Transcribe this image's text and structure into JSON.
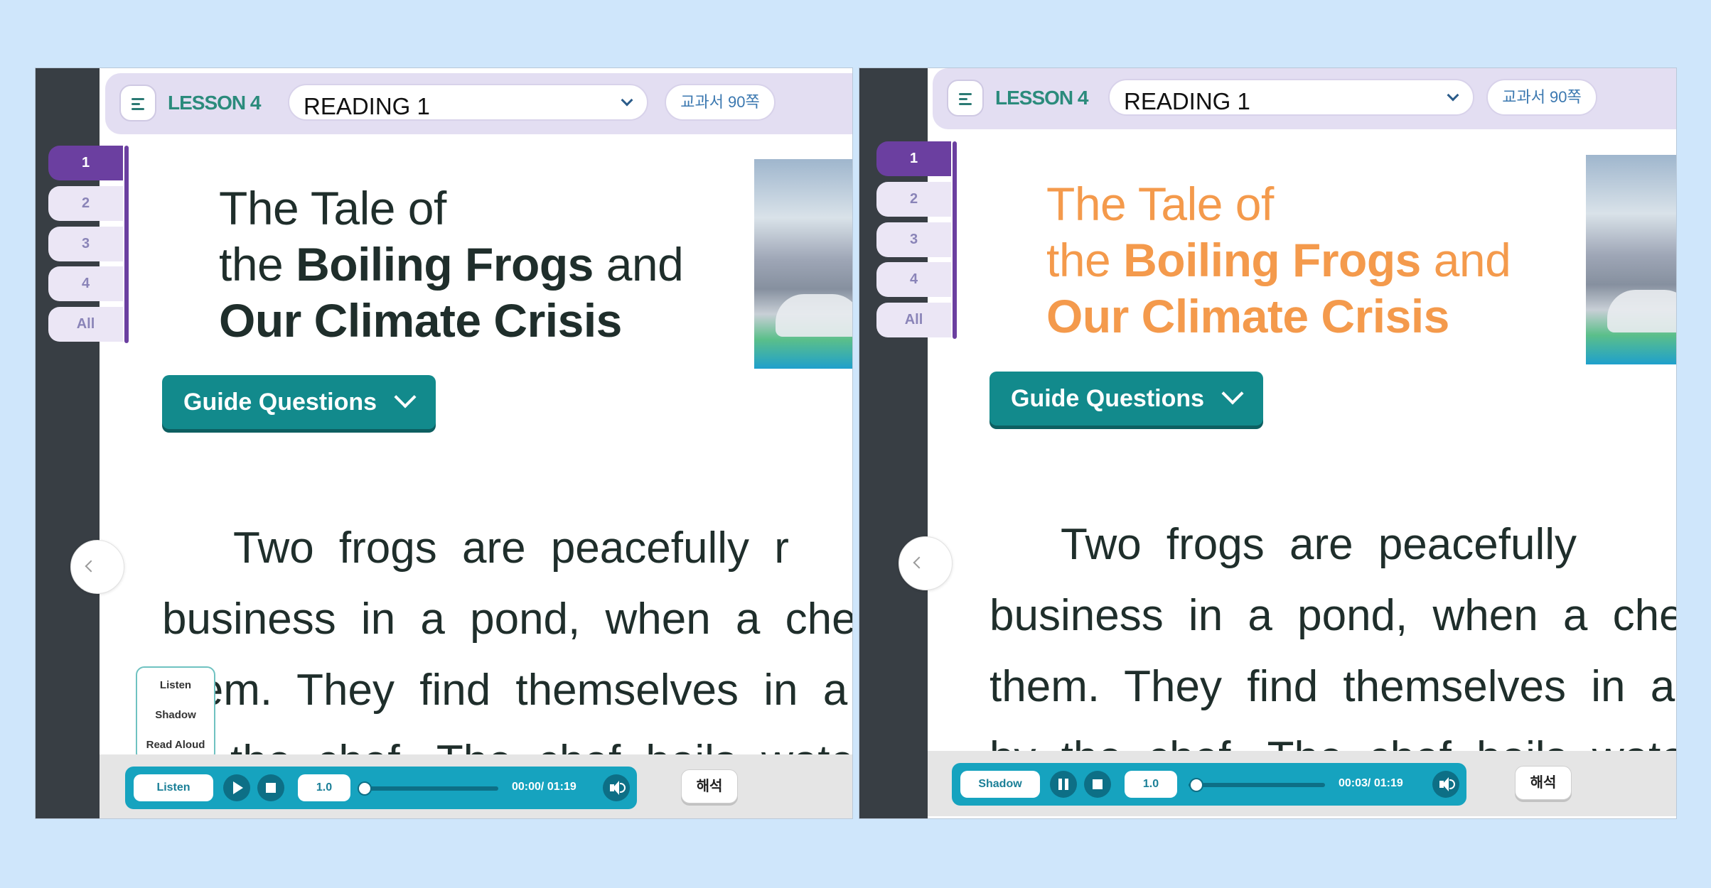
{
  "screens": [
    {
      "id": "left",
      "header": {
        "lesson": "LESSON 4",
        "reading_select": "READING 1",
        "textbook_page": "교과서 90쪽"
      },
      "tabs": [
        "1",
        "2",
        "3",
        "4",
        "All"
      ],
      "active_tab": "1",
      "title": {
        "line1": "The Tale of",
        "line2_pre": "the ",
        "line2_bold": "Boiling Frogs",
        "line2_post": " and",
        "line3_bold": "Our Climate Crisis"
      },
      "title_color": "#1f2e2b",
      "guide_button": "Guide Questions",
      "body_lines": [
        "Two frogs are peacefully r",
        "business in a pond, when a chef",
        "them. They find themselves in a k",
        "the chef. The chef boils water"
      ],
      "mode_popup": {
        "options": [
          "Listen",
          "Shadow",
          "Read Aloud"
        ]
      },
      "player": {
        "mode": "Listen",
        "state": "play",
        "speed": "1.0",
        "current_time": "00:00",
        "separator": "/",
        "total_time": "01:19",
        "progress": 0.0
      },
      "interpret_button": "해석"
    },
    {
      "id": "right",
      "header": {
        "lesson": "LESSON 4",
        "reading_select": "READING 1",
        "textbook_page": "교과서 90쪽"
      },
      "tabs": [
        "1",
        "2",
        "3",
        "4",
        "All"
      ],
      "active_tab": "1",
      "title": {
        "line1": "The Tale of",
        "line2_pre": "the ",
        "line2_bold": "Boiling Frogs",
        "line2_post": " and",
        "line3_bold": "Our Climate Crisis"
      },
      "title_color": "#f49a4c",
      "guide_button": "Guide Questions",
      "body_lines": [
        "Two frogs are peacefully",
        "business in a pond, when a che",
        "them. They find themselves in a k",
        "by the chef. The chef boils wate"
      ],
      "player": {
        "mode": "Shadow",
        "state": "pause",
        "speed": "1.0",
        "current_time": "00:03",
        "separator": "/",
        "total_time": "01:19",
        "progress": 0.04
      },
      "interpret_button": "해석"
    }
  ],
  "colors": {
    "page_background": "#cfe6fb",
    "accent_teal": "#128a8c",
    "player_blue": "#16a3bf",
    "tab_purple": "#6b3fa0",
    "highlight_orange": "#f49a4c"
  },
  "icons": [
    "menu-icon",
    "chevron-down-icon",
    "chevron-left-icon",
    "play-icon",
    "pause-icon",
    "stop-icon",
    "volume-icon"
  ]
}
